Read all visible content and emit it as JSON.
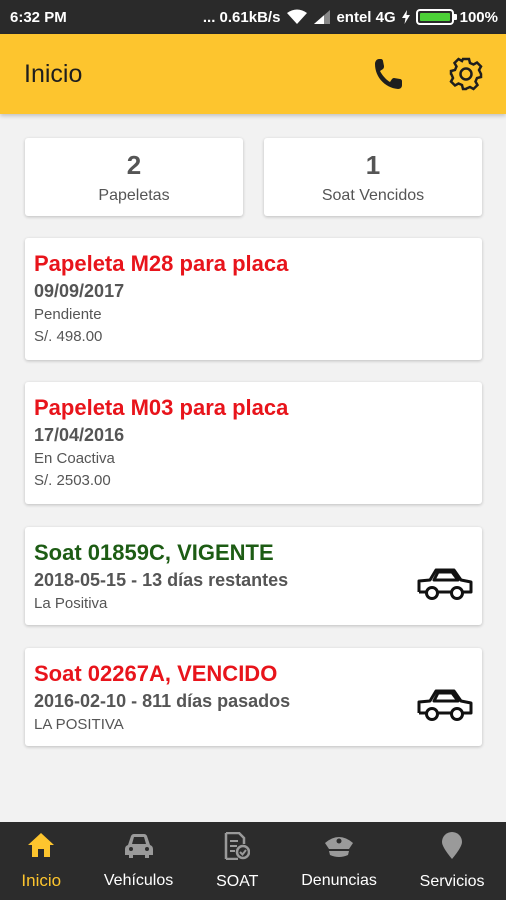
{
  "status_bar": {
    "time": "6:32 PM",
    "speed": "... 0.61kB/s",
    "carrier": "entel 4G",
    "battery": "100%",
    "battery_level": 1.0
  },
  "app_bar": {
    "title": "Inicio",
    "icons": [
      "phone-icon",
      "settings-icon"
    ]
  },
  "summary": [
    {
      "count": "2",
      "label": "Papeletas"
    },
    {
      "count": "1",
      "label": "Soat Vencidos"
    }
  ],
  "cards": [
    {
      "title": "Papeleta M28 para placa",
      "subtitle": "09/09/2017",
      "line1": "Pendiente",
      "line2": "S/. 498.00",
      "status_color": "#e8141b"
    },
    {
      "title": "Papeleta M03 para placa",
      "subtitle": "17/04/2016",
      "line1": "En Coactiva",
      "line2": "S/. 2503.00",
      "status_color": "#e8141b"
    },
    {
      "title": "Soat 01859C, VIGENTE",
      "subtitle": "2018-05-15 - 13 días restantes",
      "line1": "La Positiva",
      "status_color": "#1d5c14",
      "icon": "car-icon"
    },
    {
      "title": "Soat 02267A, VENCIDO",
      "subtitle": "2016-02-10 - 811 días pasados",
      "line1": "LA POSITIVA",
      "status_color": "#e8141b",
      "icon": "car-icon"
    }
  ],
  "bottom_nav": [
    {
      "label": "Inicio",
      "icon": "home-icon",
      "active": true
    },
    {
      "label": "Vehículos",
      "icon": "car-icon"
    },
    {
      "label": "SOAT",
      "icon": "document-check-icon"
    },
    {
      "label": "Denuncias",
      "icon": "police-cap-icon"
    },
    {
      "label": "Servicios",
      "icon": "location-pin-icon"
    }
  ],
  "colors": {
    "primary": "#fdc52e",
    "status_bar": "#2a2a2a",
    "nav_bg": "#2c2c2c",
    "red": "#e8141b",
    "green": "#1d5c14"
  }
}
